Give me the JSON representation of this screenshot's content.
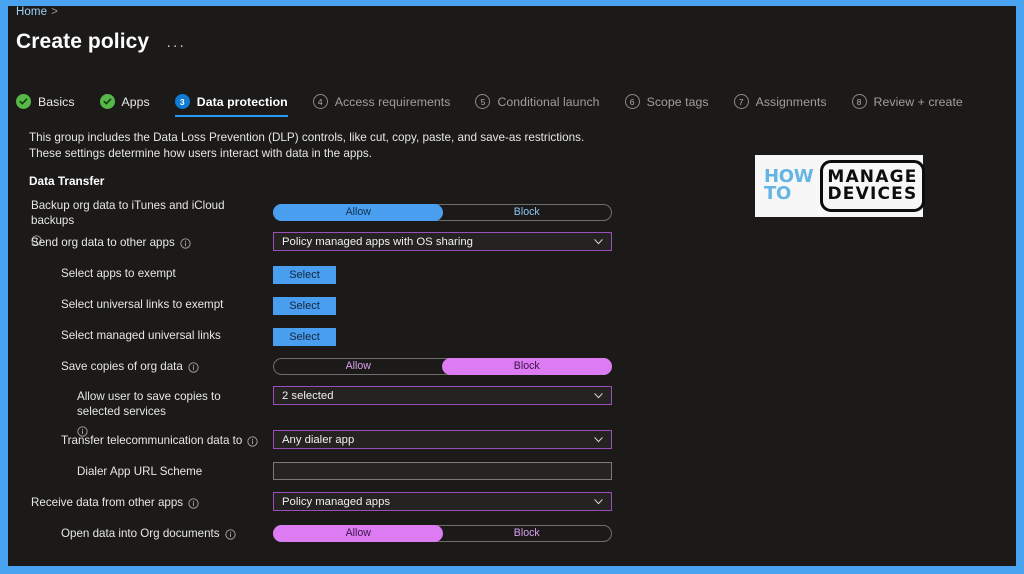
{
  "window": {
    "frame_color": "#4aa3f0",
    "background": "#1b1a19"
  },
  "breadcrumb": {
    "home": "Home",
    "separator": ">"
  },
  "header": {
    "title": "Create policy",
    "more_menu": "···"
  },
  "wizard": {
    "steps": [
      {
        "badge": "✓",
        "label": "Basics",
        "state": "done"
      },
      {
        "badge": "✓",
        "label": "Apps",
        "state": "done"
      },
      {
        "badge": "3",
        "label": "Data protection",
        "state": "active"
      },
      {
        "badge": "4",
        "label": "Access requirements",
        "state": "pending"
      },
      {
        "badge": "5",
        "label": "Conditional launch",
        "state": "pending"
      },
      {
        "badge": "6",
        "label": "Scope tags",
        "state": "pending"
      },
      {
        "badge": "7",
        "label": "Assignments",
        "state": "pending"
      },
      {
        "badge": "8",
        "label": "Review + create",
        "state": "pending"
      }
    ],
    "active_accent": "#2899f5",
    "done_accent": "#55b848"
  },
  "main": {
    "description": "This group includes the Data Loss Prevention (DLP) controls, like cut, copy, paste, and save-as restrictions. These settings determine how users interact with data in the apps.",
    "section_heading": "Data Transfer",
    "rows": [
      {
        "label": "Backup org data to iTunes and iCloud backups",
        "info": true,
        "indent": 0,
        "control": "toggle",
        "options": [
          "Allow",
          "Block"
        ],
        "selected": "Allow",
        "accent": "#4a9ef0"
      },
      {
        "label": "Send org data to other apps",
        "info": true,
        "indent": 0,
        "control": "dropdown",
        "value": "Policy managed apps with OS sharing"
      },
      {
        "label": "Select apps to exempt",
        "info": false,
        "indent": 1,
        "control": "button",
        "value": "Select"
      },
      {
        "label": "Select universal links to exempt",
        "info": false,
        "indent": 1,
        "control": "button",
        "value": "Select"
      },
      {
        "label": "Select managed universal links",
        "info": false,
        "indent": 1,
        "control": "button",
        "value": "Select"
      },
      {
        "label": "Save copies of org data",
        "info": true,
        "indent": 1,
        "control": "toggle",
        "options": [
          "Allow",
          "Block"
        ],
        "selected": "Block",
        "accent": "#dd7bf2"
      },
      {
        "label": "Allow user to save copies to selected services",
        "info": true,
        "indent": 2,
        "control": "dropdown",
        "value": "2 selected"
      },
      {
        "label": "Transfer telecommunication data to",
        "info": true,
        "indent": 1,
        "control": "dropdown",
        "value": "Any dialer app"
      },
      {
        "label": "Dialer App URL Scheme",
        "info": false,
        "indent": 2,
        "control": "textinput",
        "value": "",
        "placeholder": ""
      },
      {
        "label": "Receive data from other apps",
        "info": true,
        "indent": 0,
        "control": "dropdown",
        "value": "Policy managed apps"
      },
      {
        "label": "Open data into Org documents",
        "info": true,
        "indent": 1,
        "control": "toggle",
        "options": [
          "Allow",
          "Block"
        ],
        "selected": "Allow",
        "accent": "#dd7bf2"
      }
    ]
  },
  "watermark": {
    "line1": "HOW",
    "line2": "TO",
    "box_line1": "MANAGE",
    "box_line2": "DEVICES",
    "accent": "#64b4e4"
  }
}
